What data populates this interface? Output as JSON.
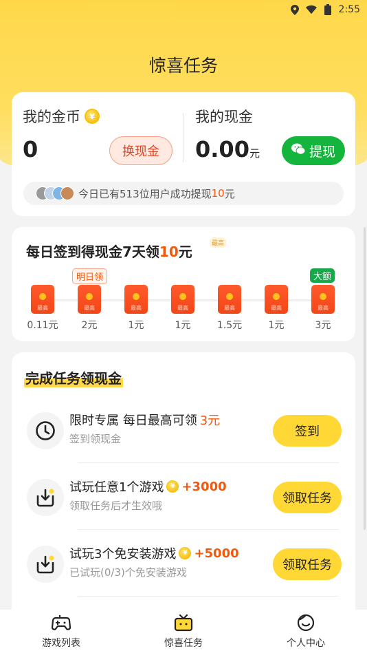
{
  "status_bar": {
    "time": "2:55"
  },
  "page": {
    "title": "惊喜任务"
  },
  "wallet": {
    "coins_label": "我的金币",
    "coins_value": "0",
    "exchange_label": "换现金",
    "cash_label": "我的现金",
    "cash_value": "0.00",
    "cash_unit": "元",
    "withdraw_label": "提现",
    "notice_prefix": "今日已有513位用户成功提现",
    "notice_amount": "10",
    "notice_suffix": "元"
  },
  "signin": {
    "title_prefix": "每日签到得现金7天领",
    "title_amount": "10",
    "title_suffix": "元",
    "max_badge": "最高",
    "tomorrow_tag": "明日领",
    "big_tag": "大额",
    "packet_tag": "最高",
    "days": [
      {
        "amount": "0.11元"
      },
      {
        "amount": "2元"
      },
      {
        "amount": "1元"
      },
      {
        "amount": "1元"
      },
      {
        "amount": "1.5元"
      },
      {
        "amount": "1元"
      },
      {
        "amount": "3元"
      }
    ]
  },
  "tasks": {
    "title": "完成任务领现金",
    "items": [
      {
        "title": "限时专属 每日最高可领",
        "reward": "3元",
        "subtitle": "签到领现金",
        "button": "签到",
        "icon": "clock-icon"
      },
      {
        "title": "试玩任意1个游戏",
        "reward": "+3000",
        "subtitle": "领取任务后才生效哦",
        "button": "领取任务",
        "icon": "download-icon"
      },
      {
        "title": "试玩3个免安装游戏",
        "reward": "+5000",
        "subtitle": "已试玩(0/3)个免安装游戏",
        "button": "领取任务",
        "icon": "download-icon"
      }
    ]
  },
  "nav": {
    "items": [
      {
        "label": "游戏列表",
        "icon": "gamepad-icon"
      },
      {
        "label": "惊喜任务",
        "icon": "gift-tv-icon"
      },
      {
        "label": "个人中心",
        "icon": "face-icon"
      }
    ]
  },
  "colors": {
    "accent": "#ffd836",
    "green": "#14b53c",
    "highlight": "#f2590c"
  }
}
